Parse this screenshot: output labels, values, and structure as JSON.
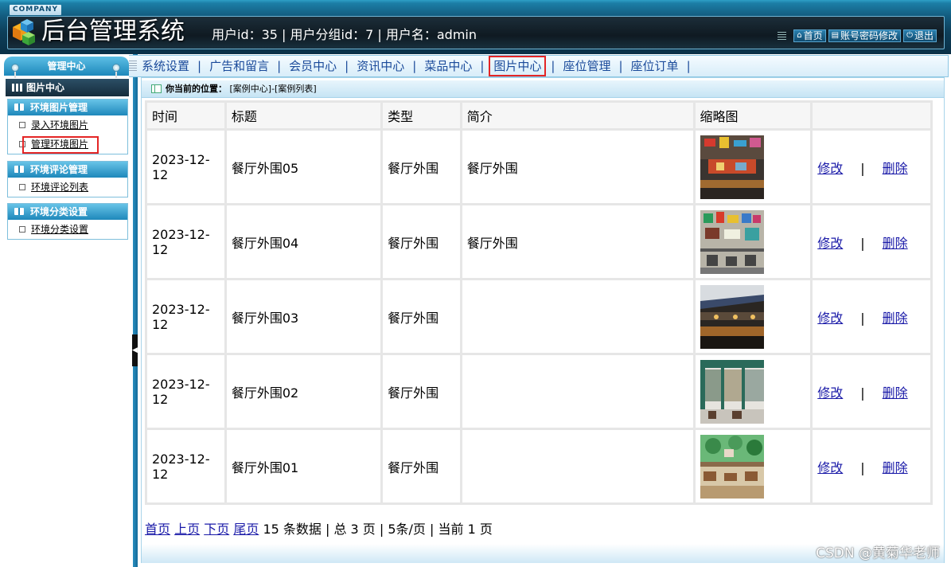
{
  "header": {
    "company": "COMPANY",
    "title": "后台管理系统",
    "user_info": "用户id：35 | 用户分组id：7 | 用户名：admin",
    "links": [
      {
        "icon": "home-icon",
        "label": "首页"
      },
      {
        "icon": "list-icon",
        "label": "账号密码修改"
      },
      {
        "icon": "power-icon",
        "label": "退出"
      }
    ]
  },
  "sidebar": {
    "title": "管理中心",
    "current": "图片中心",
    "groups": [
      {
        "title": "环境图片管理",
        "items": [
          "录入环境图片",
          "管理环境图片"
        ]
      },
      {
        "title": "环境评论管理",
        "items": [
          "环境评论列表"
        ]
      },
      {
        "title": "环境分类设置",
        "items": [
          "环境分类设置"
        ]
      }
    ]
  },
  "nav": {
    "items": [
      "系统设置",
      "广告和留言",
      "会员中心",
      "资讯中心",
      "菜品中心",
      "图片中心",
      "座位管理",
      "座位订单"
    ],
    "active_index": 5,
    "separator": "|"
  },
  "breadcrumb": {
    "label": "你当前的位置：",
    "path": "[案例中心]-[案例列表]"
  },
  "table": {
    "headers": [
      "时间",
      "标题",
      "类型",
      "简介",
      "缩略图",
      ""
    ],
    "rows": [
      {
        "time": "2023-12-12",
        "title": "餐厅外围05",
        "type": "餐厅外围",
        "intro": "餐厅外围"
      },
      {
        "time": "2023-12-12",
        "title": "餐厅外围04",
        "type": "餐厅外围",
        "intro": "餐厅外围"
      },
      {
        "time": "2023-12-12",
        "title": "餐厅外围03",
        "type": "餐厅外围",
        "intro": ""
      },
      {
        "time": "2023-12-12",
        "title": "餐厅外围02",
        "type": "餐厅外围",
        "intro": ""
      },
      {
        "time": "2023-12-12",
        "title": "餐厅外围01",
        "type": "餐厅外围",
        "intro": ""
      }
    ],
    "edit_label": "修改",
    "delete_label": "删除",
    "action_sep": "|"
  },
  "pager": {
    "first": "首页",
    "prev": "上页",
    "next": "下页",
    "last": "尾页",
    "summary": "15 条数据 | 总 3 页 | 5条/页 | 当前 1 页"
  },
  "watermark": "CSDN @黄菊华老师",
  "colors": {
    "header_dark": "#0d3f5a",
    "accent_blue": "#1e88bb",
    "nav_text": "#1a4a9a",
    "highlight_red": "#e42525",
    "link": "#1a1aa8"
  }
}
